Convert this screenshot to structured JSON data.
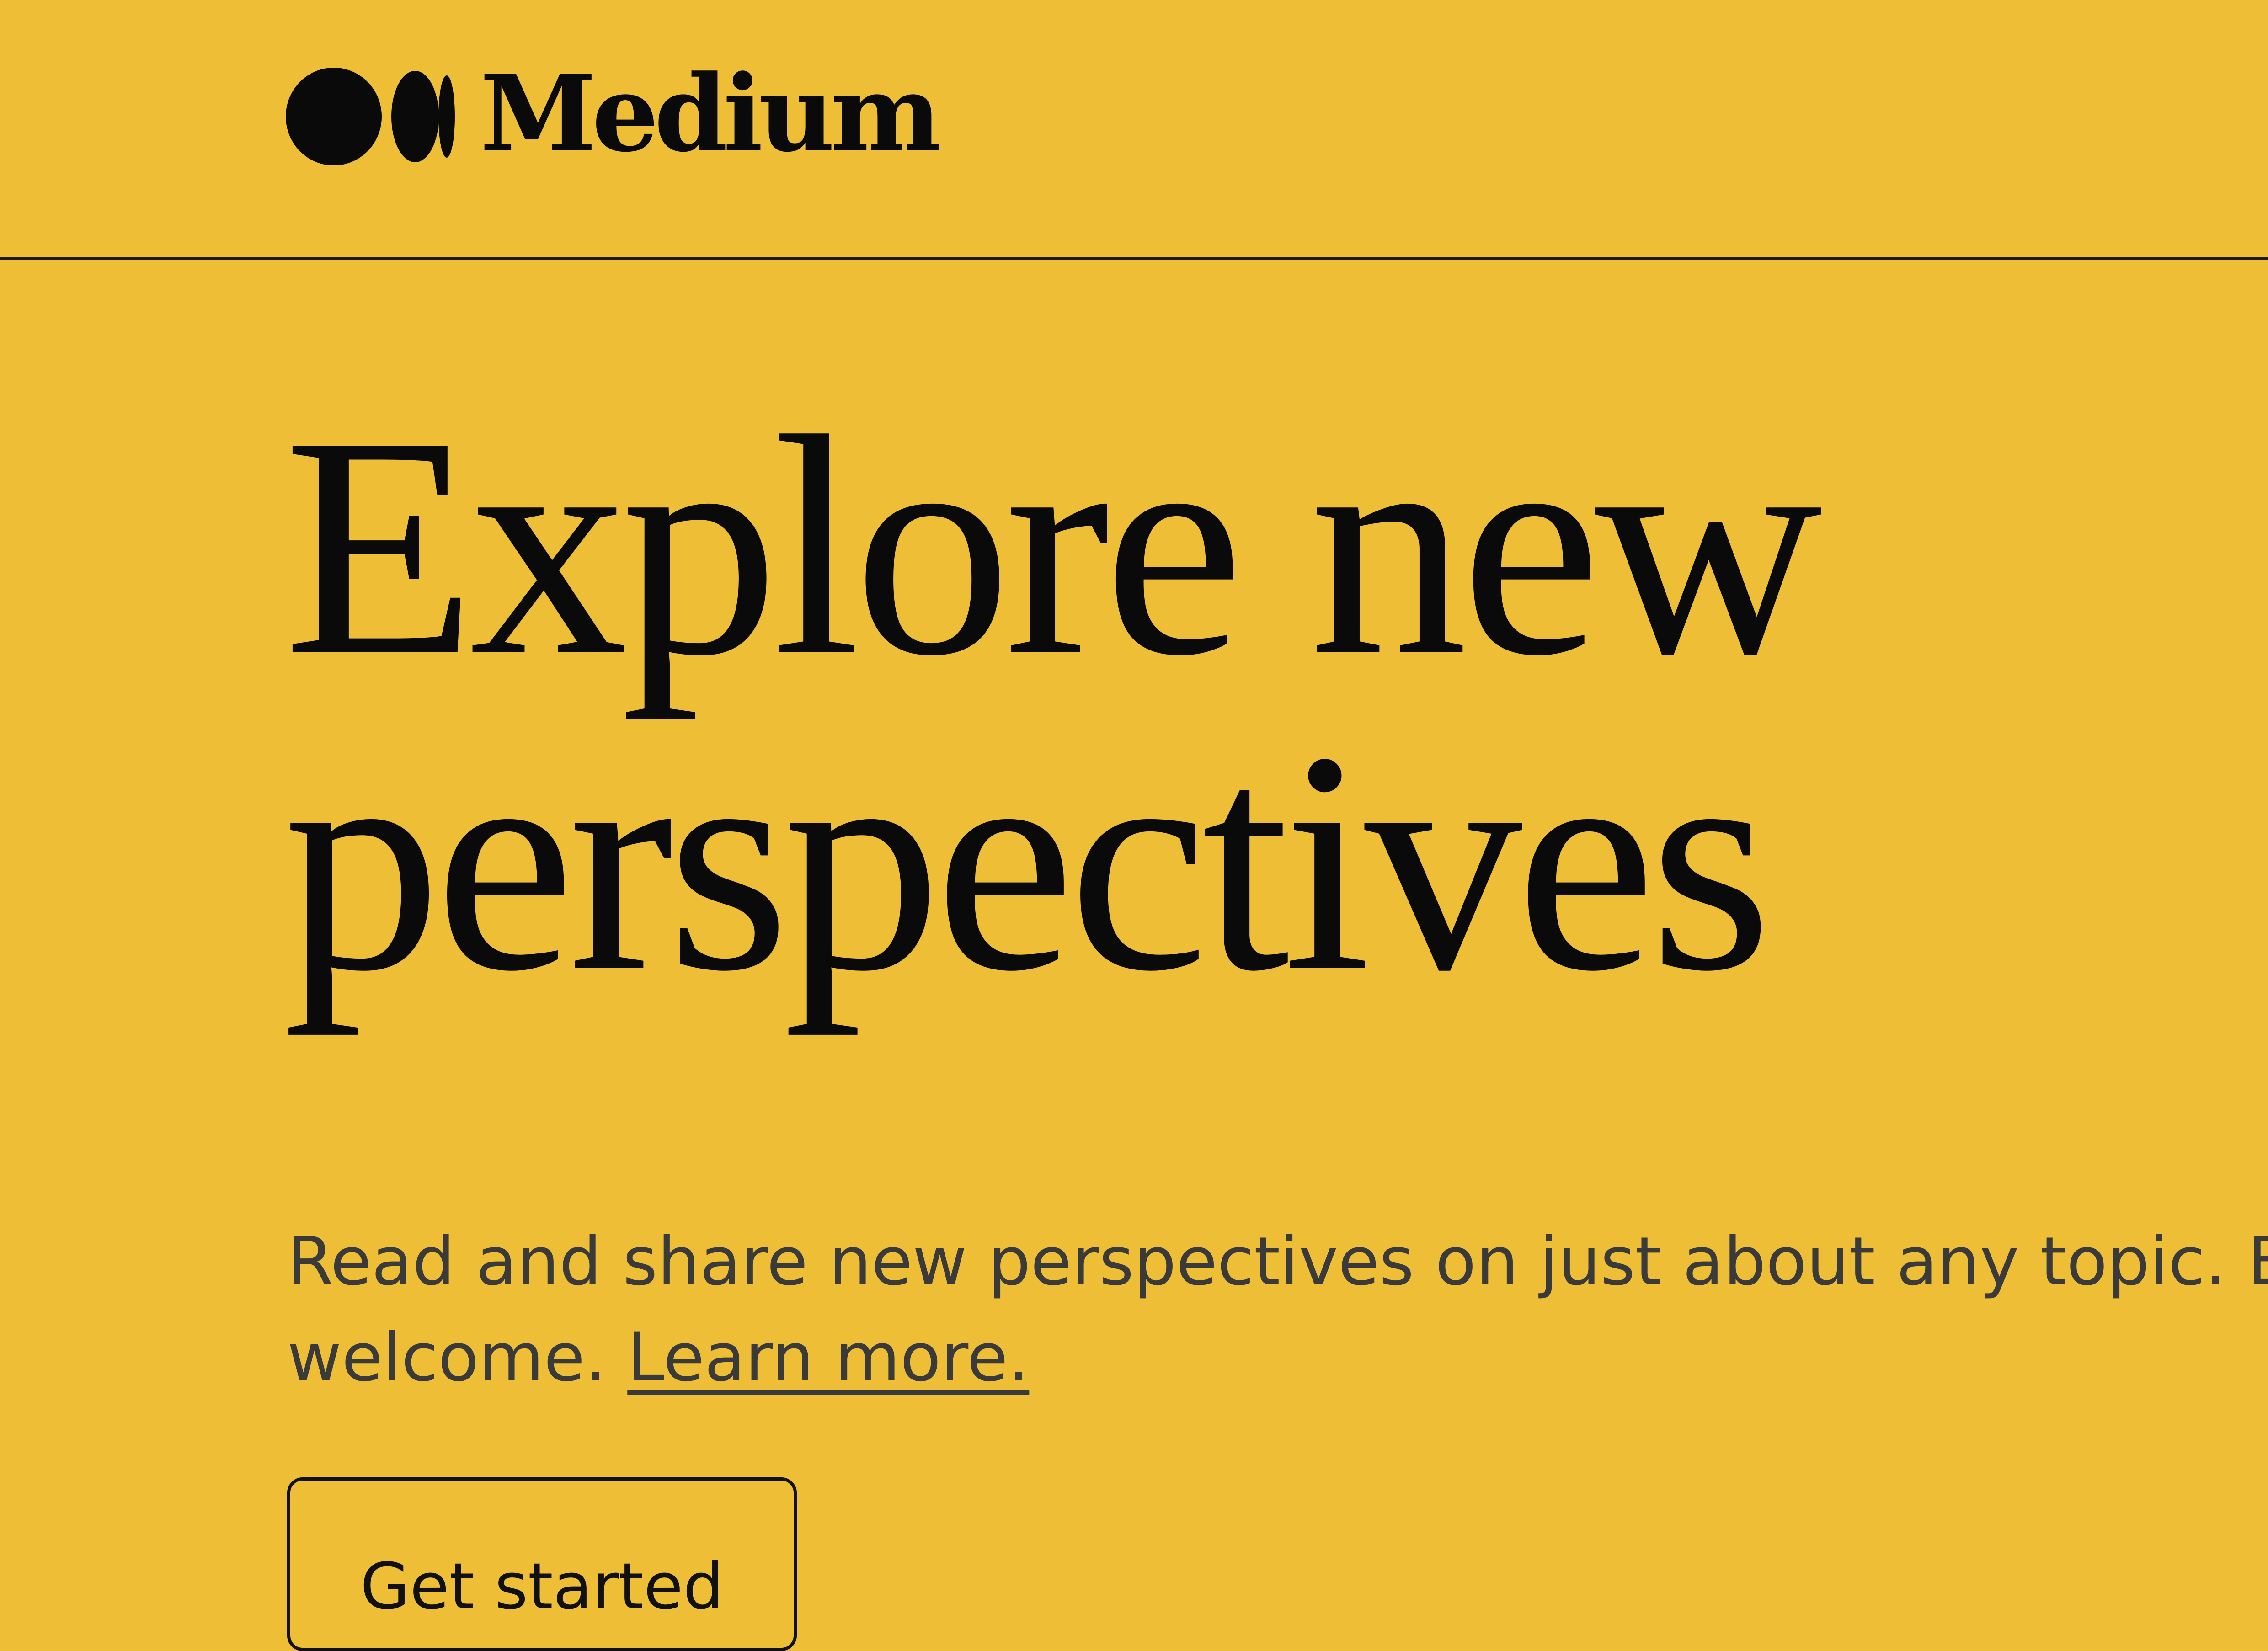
{
  "header": {
    "logo_text": "Medium",
    "logo_icon": "medium-logo-icon"
  },
  "hero": {
    "title_line1": "Explore new",
    "title_line2": "perspectives",
    "subtitle_line1": "Read and share new perspectives on just about any topic. Every",
    "subtitle_line2_prefix": "welcome. ",
    "learn_more_label": "Learn more.",
    "cta_label": "Get started"
  },
  "colors": {
    "background": "#EEBF36",
    "text_primary": "#0A0A0A",
    "text_secondary": "#3A3A3A"
  }
}
